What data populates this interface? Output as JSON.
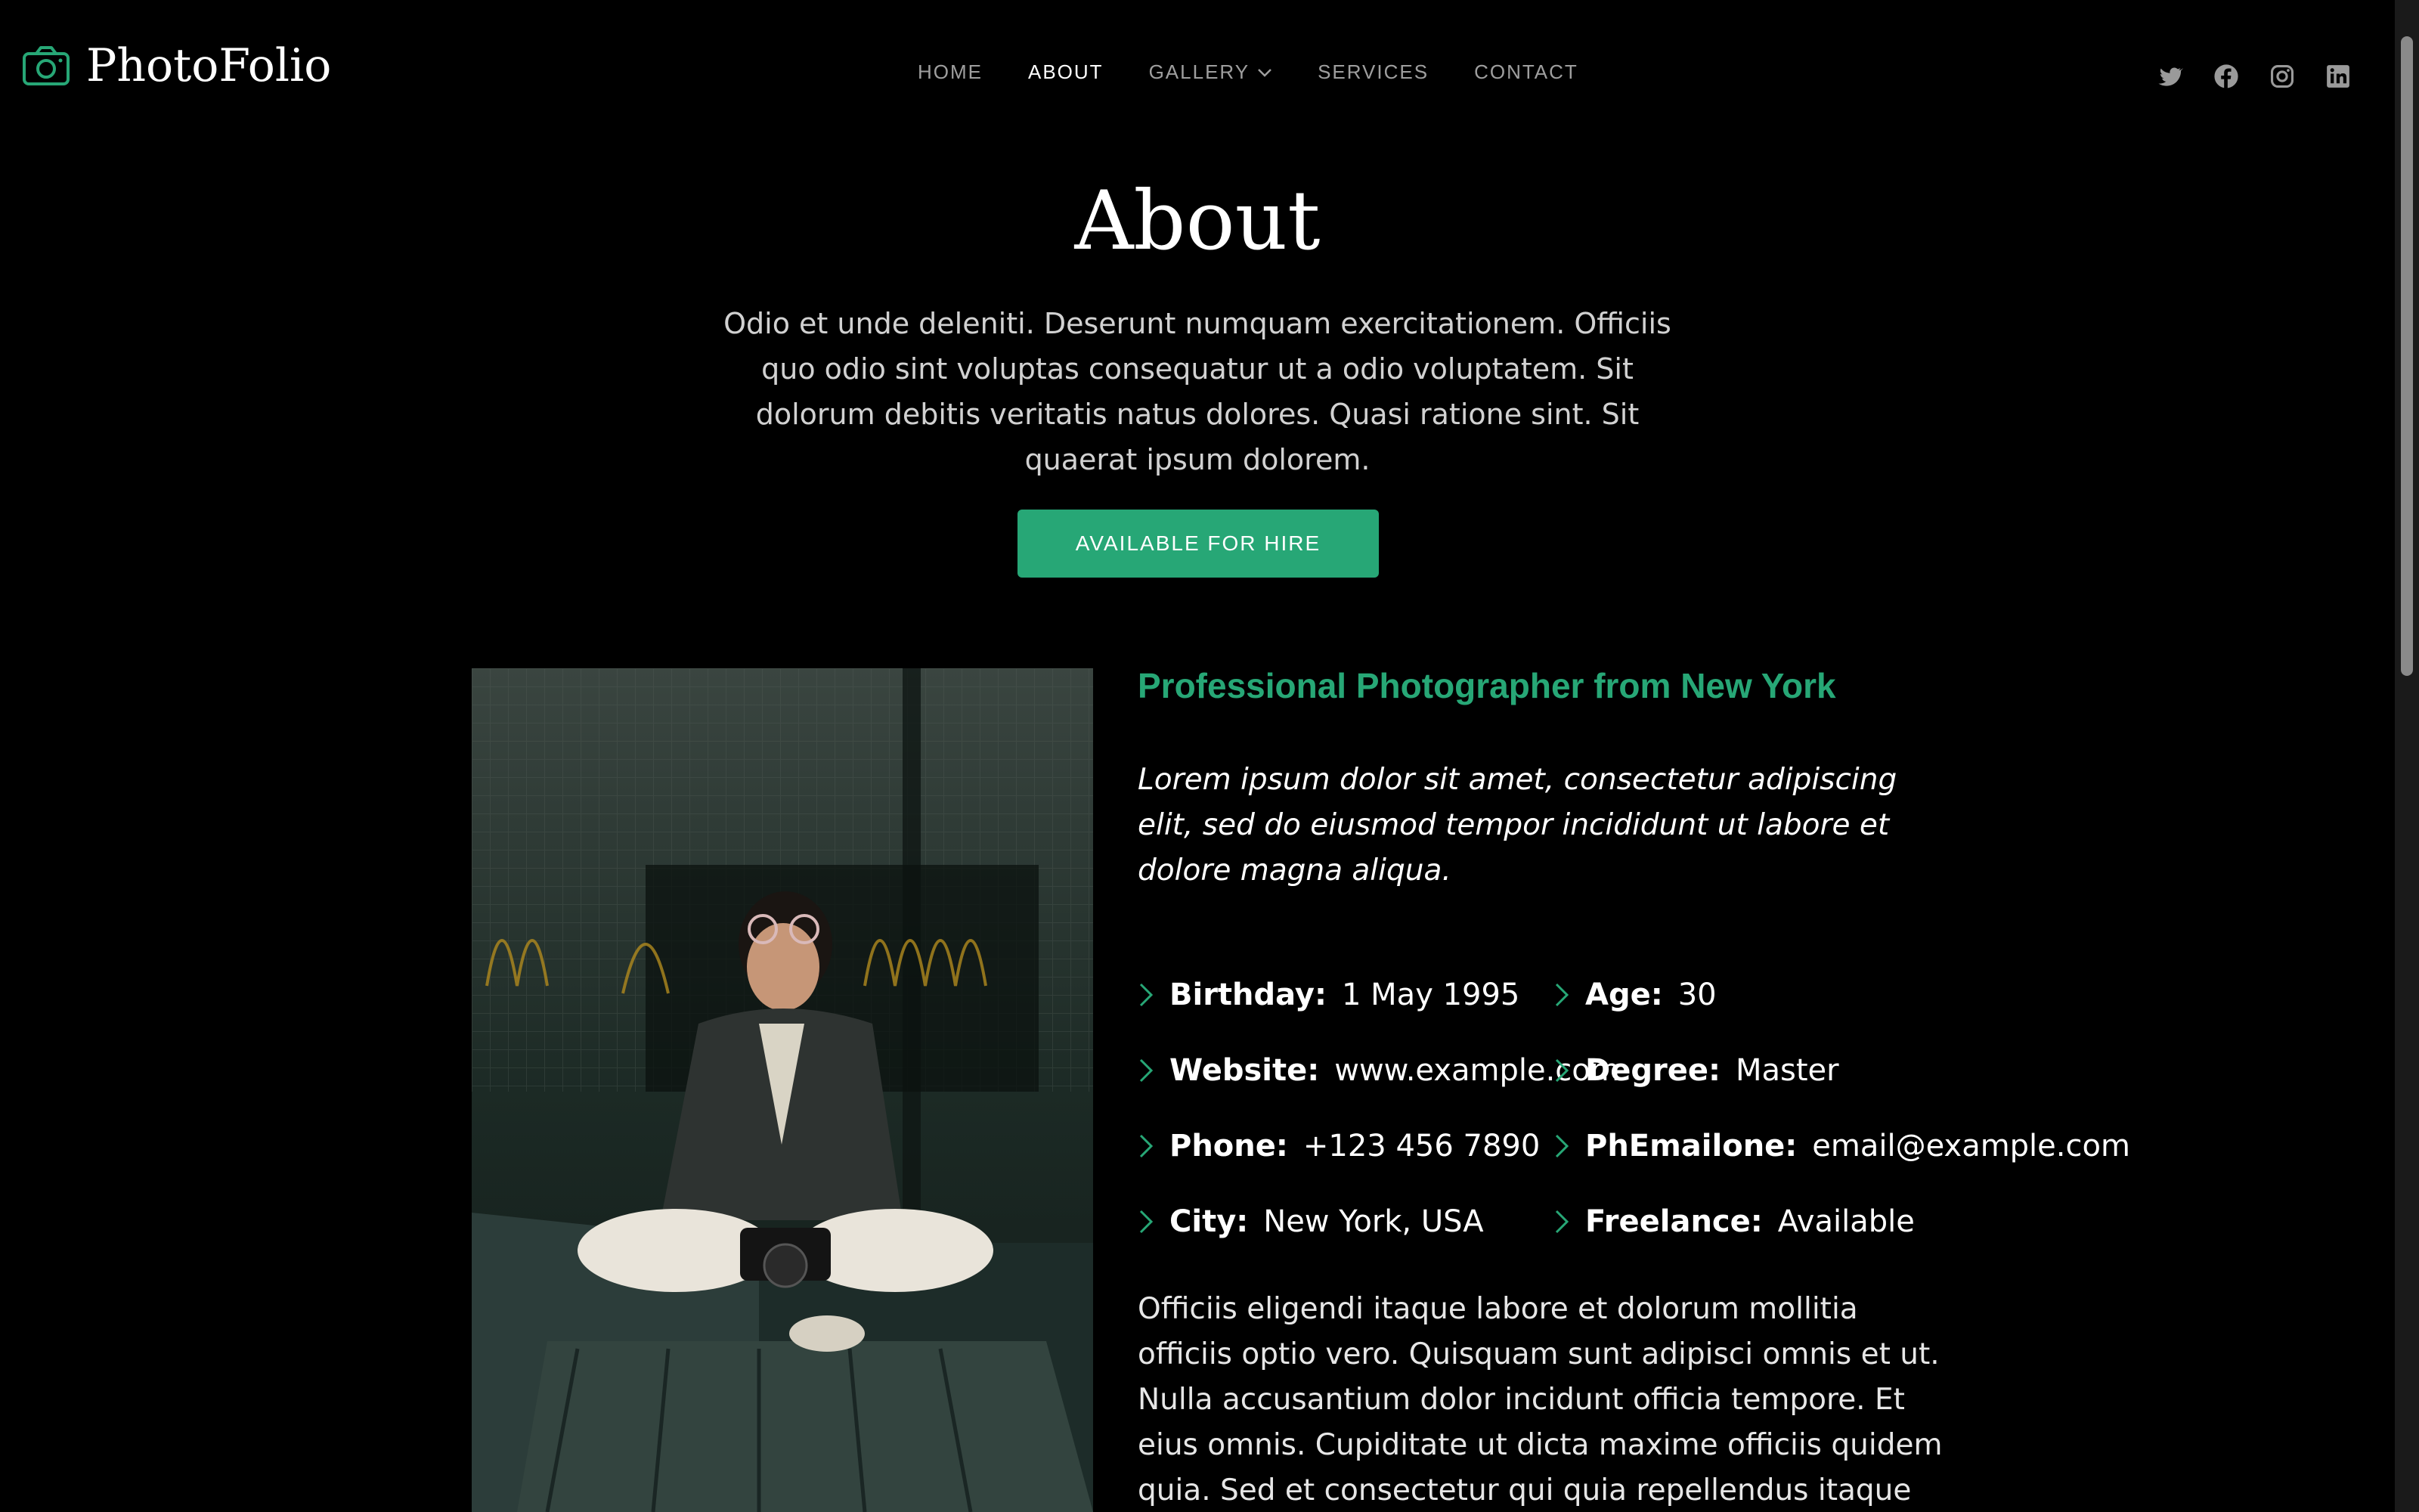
{
  "brand": {
    "name": "PhotoFolio",
    "accent": "#27a776"
  },
  "nav": {
    "items": [
      {
        "label": "HOME",
        "active": false
      },
      {
        "label": "ABOUT",
        "active": true
      },
      {
        "label": "GALLERY",
        "active": false,
        "has_dropdown": true
      },
      {
        "label": "SERVICES",
        "active": false
      },
      {
        "label": "CONTACT",
        "active": false
      }
    ]
  },
  "socials": [
    "twitter-icon",
    "facebook-icon",
    "instagram-icon",
    "linkedin-icon"
  ],
  "hero": {
    "title": "About",
    "intro": "Odio et unde deleniti. Deserunt numquam exercitationem. Officiis quo odio sint voluptas consequatur ut a odio voluptatem. Sit dolorum debitis veritatis natus dolores. Quasi ratione sint. Sit quaerat ipsum dolorem.",
    "cta": "AVAILABLE FOR HIRE"
  },
  "about": {
    "heading": "Professional Photographer from New York",
    "quote": "Lorem ipsum dolor sit amet, consectetur adipiscing elit, sed do eiusmod tempor incididunt ut labore et dolore magna aliqua.",
    "info_left": [
      {
        "label": "Birthday:",
        "value": "1 May 1995"
      },
      {
        "label": "Website:",
        "value": "www.example.com"
      },
      {
        "label": "Phone:",
        "value": "+123 456 7890"
      },
      {
        "label": "City:",
        "value": "New York, USA"
      }
    ],
    "info_right": [
      {
        "label": "Age:",
        "value": "30"
      },
      {
        "label": "Degree:",
        "value": "Master"
      },
      {
        "label": "PhEmailone:",
        "value": "email@example.com"
      },
      {
        "label": "Freelance:",
        "value": "Available"
      }
    ],
    "body": "Officiis eligendi itaque labore et dolorum mollitia officiis optio vero. Quisquam sunt adipisci omnis et ut. Nulla accusantium dolor incidunt officia tempore. Et eius omnis. Cupiditate ut dicta maxime officiis quidem quia. Sed et consectetur qui quia repellendus itaque neque."
  }
}
